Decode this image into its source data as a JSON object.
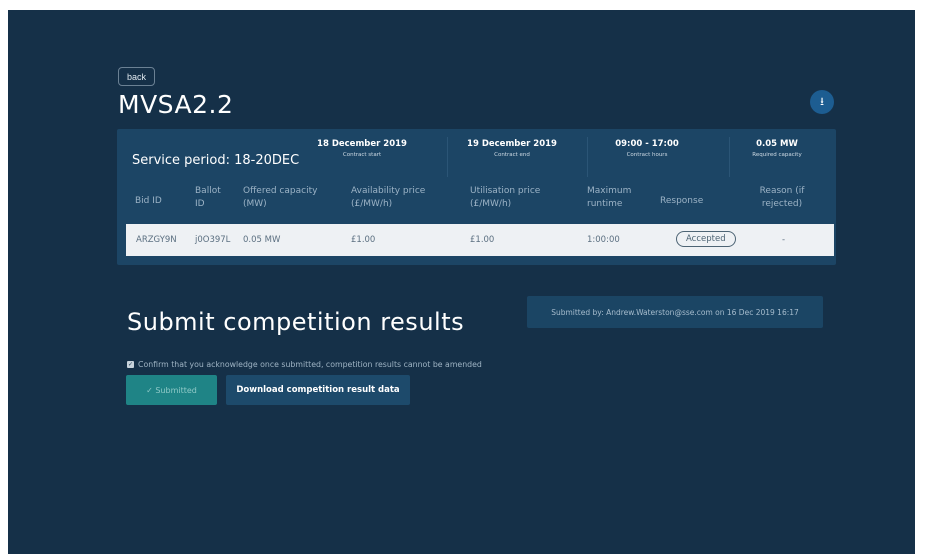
{
  "nav": {
    "back_label": "back"
  },
  "header": {
    "title": "MVSA2.2",
    "download_icon": "download-icon"
  },
  "service": {
    "period_label": "Service period: 18-20DEC",
    "stats": [
      {
        "value": "18 December 2019",
        "label": "Contract start"
      },
      {
        "value": "19 December 2019",
        "label": "Contract end"
      },
      {
        "value": "09:00 - 17:00",
        "label": "Contract hours"
      },
      {
        "value": "0.05 MW",
        "label": "Required capacity"
      }
    ]
  },
  "table": {
    "headers": [
      "Bid ID",
      "Ballot\nID",
      "Offered capacity\n(MW)",
      "Availability price\n(£/MW/h)",
      "Utilisation price\n(£/MW/h)",
      "Maximum\nruntime",
      "Response",
      "Reason (if\nrejected)"
    ],
    "rows": [
      {
        "bid_id": "ARZGY9N",
        "ballot_id": "j0O397L",
        "capacity": "0.05 MW",
        "availability_price": "£1.00",
        "utilisation_price": "£1.00",
        "max_runtime": "1:00:00",
        "response": "Accepted",
        "reason": "-"
      }
    ]
  },
  "submit": {
    "title": "Submit competition results",
    "submitted_by": "Submitted by: Andrew.Waterston@sse.com on 16 Dec 2019 16:17",
    "confirm_text": "Confirm that you acknowledge once submitted, competition results cannot be amended",
    "submitted_label": "✓ Submitted",
    "download_label": "Download competition result data"
  },
  "colors": {
    "background": "#153048",
    "panel": "#1c4565",
    "accent_teal": "#1f8486",
    "row_bg": "#eef1f4"
  }
}
